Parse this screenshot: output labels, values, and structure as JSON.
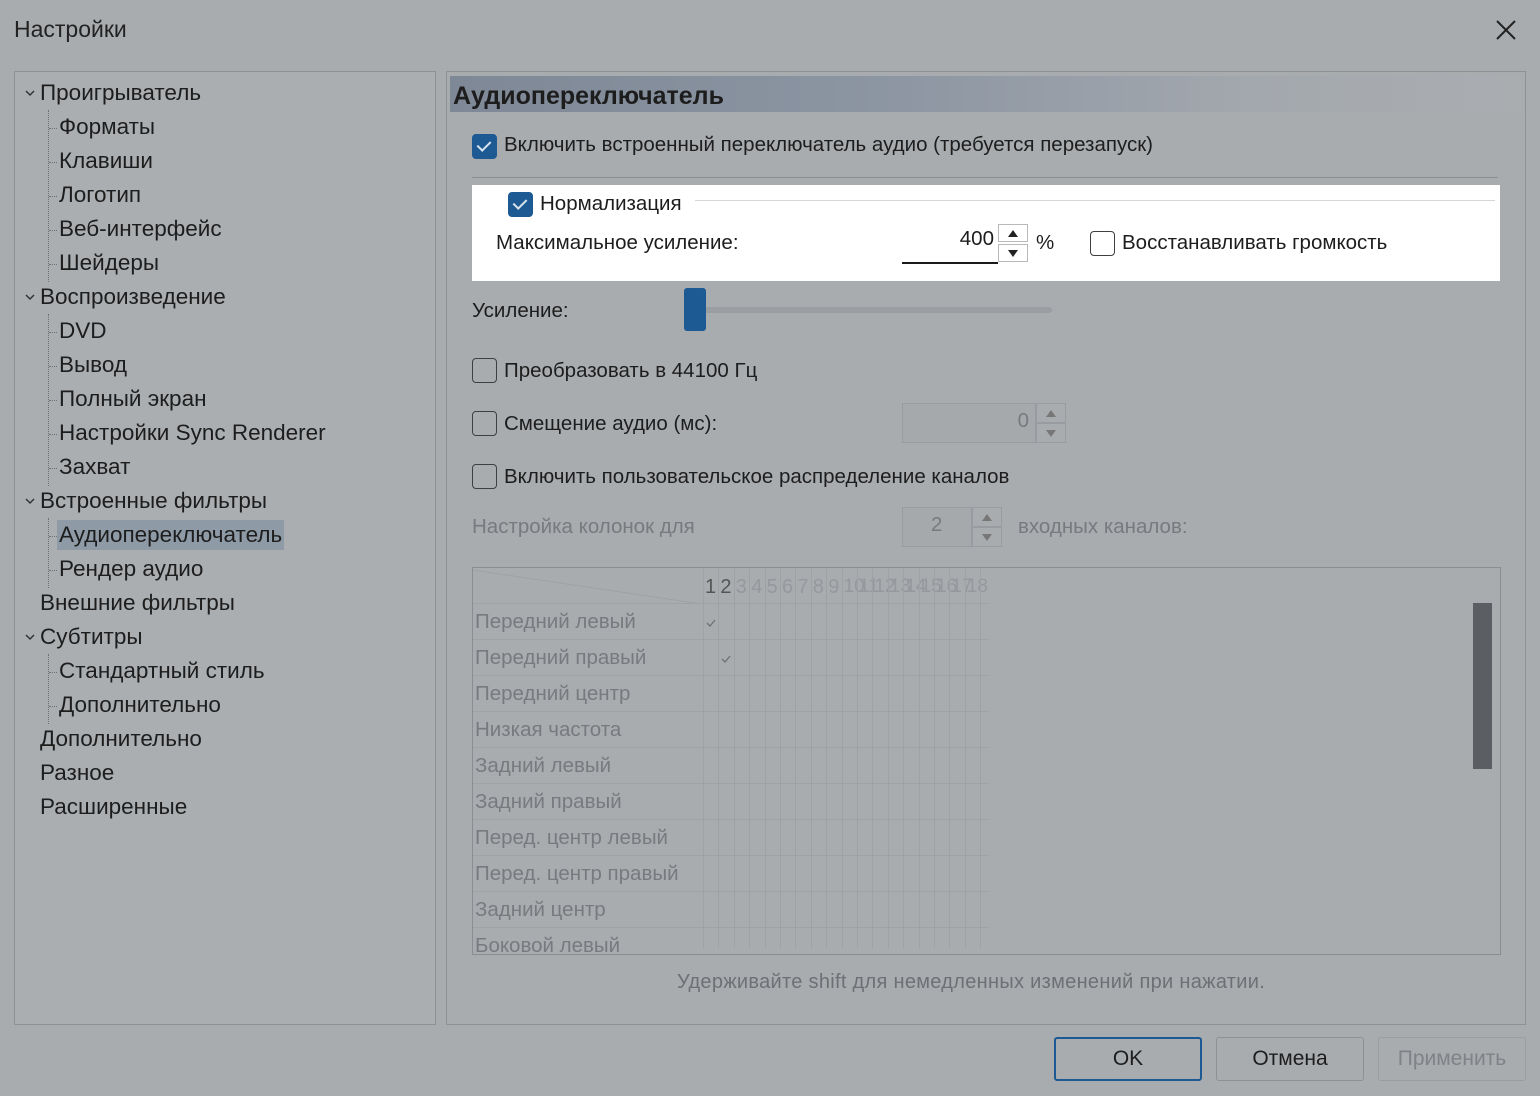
{
  "window": {
    "title": "Настройки",
    "close_icon": "close-icon"
  },
  "tree": {
    "items": [
      {
        "label": "Проигрыватель",
        "level": 0,
        "expanded": true
      },
      {
        "label": "Форматы",
        "level": 1
      },
      {
        "label": "Клавиши",
        "level": 1
      },
      {
        "label": "Логотип",
        "level": 1
      },
      {
        "label": "Веб-интерфейс",
        "level": 1
      },
      {
        "label": "Шейдеры",
        "level": 1
      },
      {
        "label": "Воспроизведение",
        "level": 0,
        "expanded": true
      },
      {
        "label": "DVD",
        "level": 1
      },
      {
        "label": "Вывод",
        "level": 1
      },
      {
        "label": "Полный экран",
        "level": 1
      },
      {
        "label": "Настройки Sync Renderer",
        "level": 1
      },
      {
        "label": "Захват",
        "level": 1
      },
      {
        "label": "Встроенные фильтры",
        "level": 0,
        "expanded": true
      },
      {
        "label": "Аудиопереключатель",
        "level": 1,
        "selected": true
      },
      {
        "label": "Рендер аудио",
        "level": 1
      },
      {
        "label": "Внешние фильтры",
        "level": 0
      },
      {
        "label": "Субтитры",
        "level": 0,
        "expanded": true
      },
      {
        "label": "Стандартный стиль",
        "level": 1
      },
      {
        "label": "Дополнительно",
        "level": 1
      },
      {
        "label": "Дополнительно",
        "level": 0
      },
      {
        "label": "Разное",
        "level": 0
      },
      {
        "label": "Расширенные",
        "level": 0
      }
    ]
  },
  "page": {
    "header": "Аудиопереключатель",
    "enable_switcher": {
      "label": "Включить встроенный переключатель аудио (требуется перезапуск)",
      "checked": true
    },
    "normalization": {
      "label": "Нормализация",
      "checked": true,
      "max_gain_label": "Максимальное усиление:",
      "max_gain_value": "400",
      "unit": "%",
      "restore_volume": {
        "label": "Восстанавливать громкость",
        "checked": false
      }
    },
    "gain": {
      "label": "Усиление:",
      "value": 0
    },
    "resample": {
      "label": "Преобразовать в 44100 Гц",
      "checked": false
    },
    "audio_offset": {
      "label": "Смещение аудио (мс):",
      "checked": false,
      "value": "0"
    },
    "custom_channels": {
      "label": "Включить пользовательское распределение каналов",
      "checked": false
    },
    "speaker_setup": {
      "prefix": "Настройка колонок для",
      "value": "2",
      "suffix": "входных каналов:"
    },
    "matrix": {
      "columns": [
        "1",
        "2",
        "3",
        "4",
        "5",
        "6",
        "7",
        "8",
        "9",
        "10",
        "11",
        "12",
        "13",
        "14",
        "15",
        "16",
        "17",
        "18"
      ],
      "rows": [
        {
          "label": "Передний левый",
          "check": 1
        },
        {
          "label": "Передний правый",
          "check": 2
        },
        {
          "label": "Передний центр"
        },
        {
          "label": "Низкая частота"
        },
        {
          "label": "Задний левый"
        },
        {
          "label": "Задний правый"
        },
        {
          "label": "Перед. центр левый"
        },
        {
          "label": "Перед. центр правый"
        },
        {
          "label": "Задний центр"
        },
        {
          "label": "Боковой левый"
        }
      ]
    },
    "hint": "Удерживайте shift для немедленных изменений при нажатии."
  },
  "buttons": {
    "ok": "OK",
    "cancel": "Отмена",
    "apply": "Применить"
  }
}
